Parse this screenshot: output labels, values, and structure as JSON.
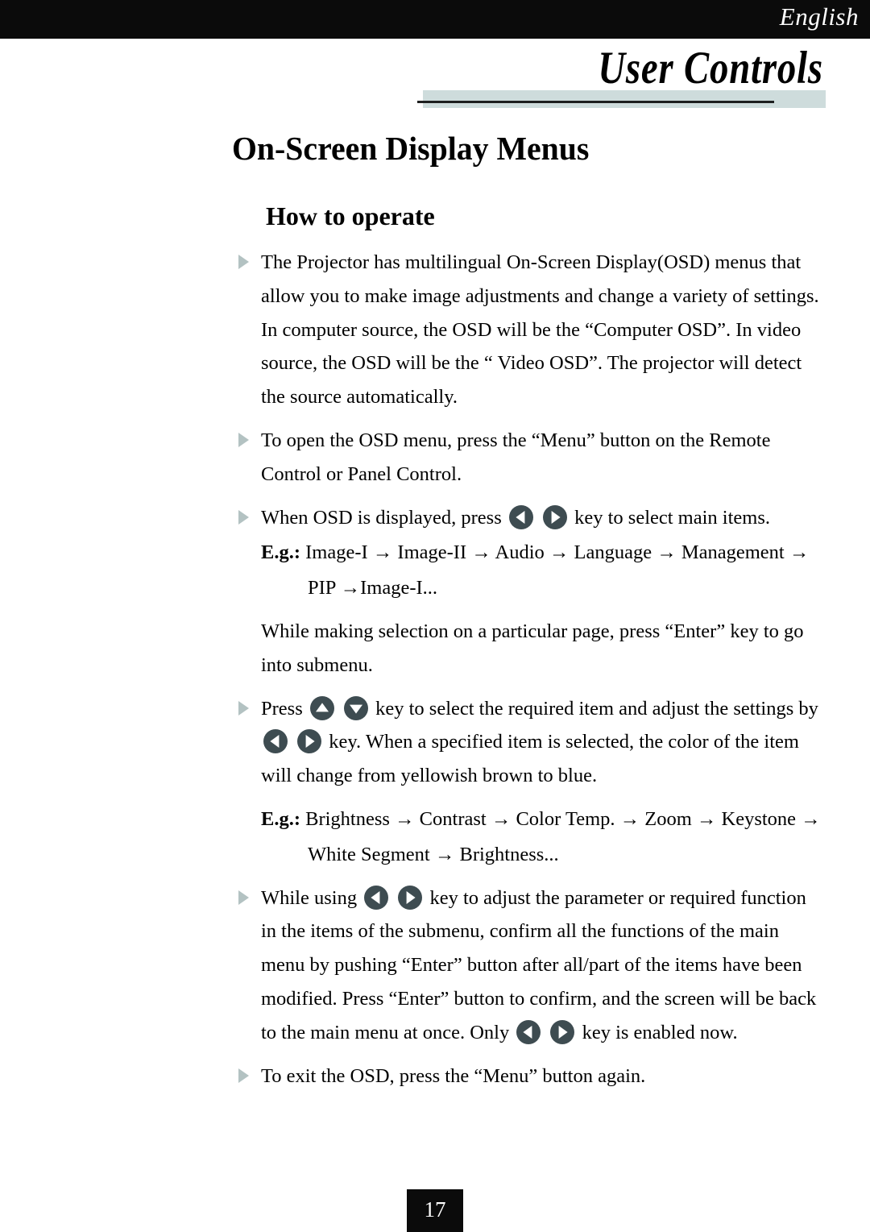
{
  "header": {
    "language_label": "English",
    "chapter_title": "User Controls"
  },
  "headings": {
    "page_heading": "On-Screen Display Menus",
    "sub_heading": "How to operate"
  },
  "colors": {
    "header_bar": "#0b0b0b",
    "rule_bar": "#cedcdc",
    "rule_line": "#1d1f1f",
    "bullet": "#b3c2c2",
    "key_icon": "#3e4c51",
    "key_arrow": "#ffffff",
    "text": "#000000"
  },
  "body": {
    "bullet_1": {
      "text": "The Projector has multilingual On-Screen Display(OSD) menus that allow you to make image adjustments and change a variety of settings. In computer source, the OSD will be the “Computer OSD”. In video source, the OSD will be the “ Video OSD”. The projector will detect the source automatically."
    },
    "bullet_2": {
      "text": "To open the OSD menu, press the “Menu” button on the Remote Control or Panel Control."
    },
    "bullet_3": {
      "text_before": "When OSD is displayed, press",
      "key_left": "left-arrow-key",
      "key_right": "right-arrow-key",
      "text_after": "key to select main items."
    },
    "eg_1": {
      "label": "E.g.:",
      "sequence_line1": "Image-I →  Image-II →  Audio →  Language →  Management →",
      "sequence_line2": "PIP →Image-I..."
    },
    "paragraph_1": {
      "text": "While making selection on a particular page, press “Enter” key to go into submenu."
    },
    "bullet_4": {
      "text_1": "Press",
      "key_up": "up-arrow-key",
      "key_down": "down-arrow-key",
      "text_2": "key to select the required item and adjust the settings by",
      "key_left": "left-arrow-key",
      "key_right": "right-arrow-key",
      "text_3": "key.  When a specified item is selected, the color of the item will change from yellowish brown to blue."
    },
    "eg_2": {
      "label": "E.g.:",
      "sequence_line1": "Brightness →  Contrast →  Color Temp. →  Zoom →  Keystone →",
      "sequence_line2": "White Segment → Brightness..."
    },
    "bullet_5": {
      "text_1": "While using",
      "key_left": "left-arrow-key",
      "key_right": "right-arrow-key",
      "text_2": "key to adjust the parameter or required function in the items of the submenu, confirm all the functions of the main menu by pushing “Enter” button after all/part of the items have been modified.  Press “Enter” button to confirm, and the screen will be back to the main menu at once.  Only",
      "key_left_2": "left-arrow-key",
      "key_right_2": "right-arrow-key",
      "text_3": "key is enabled now."
    },
    "bullet_6": {
      "text": "To exit the OSD, press the “Menu” button again."
    }
  },
  "footer": {
    "page_number": "17"
  }
}
